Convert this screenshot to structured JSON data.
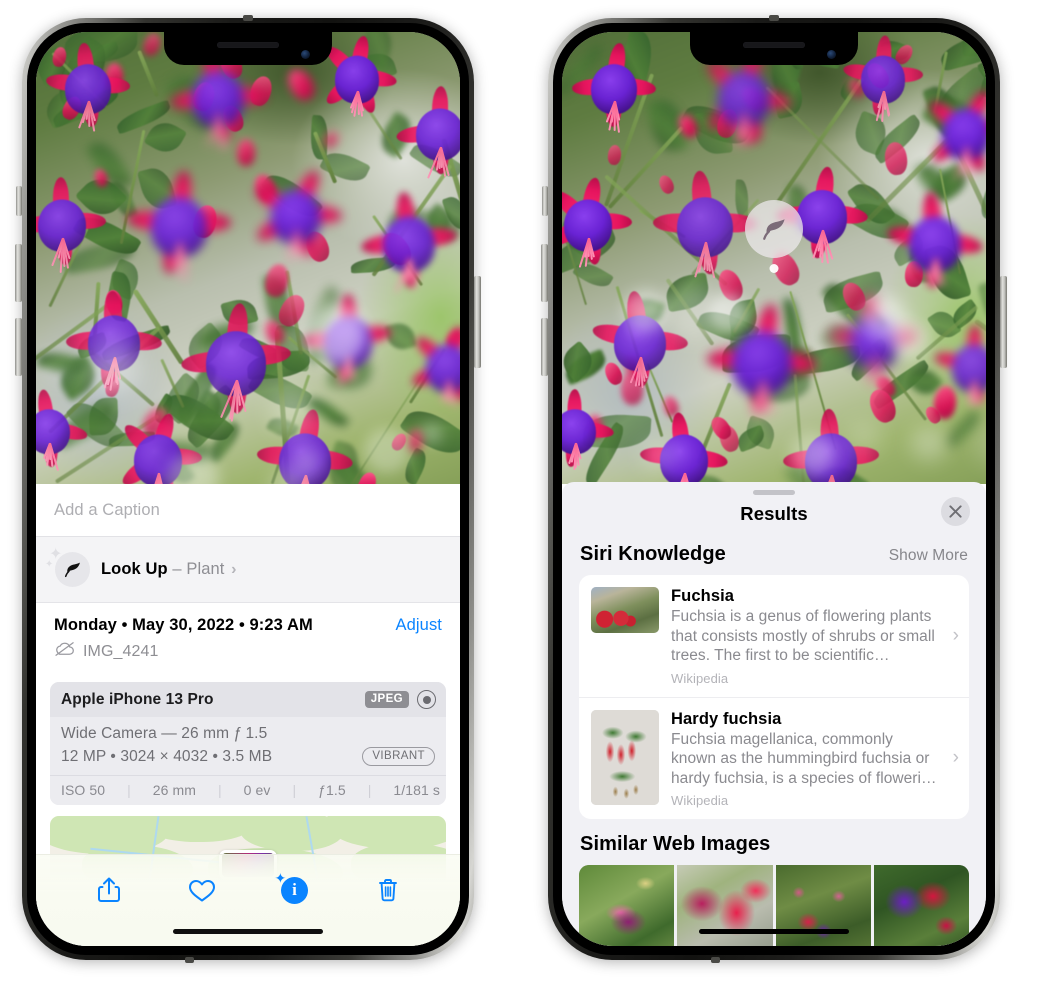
{
  "meta": {
    "accent_blue": "#0a84ff",
    "sheet_bg": "#f1f1f5",
    "card_bg": "#ffffff"
  },
  "left_phone": {
    "caption": {
      "placeholder": "Add a Caption",
      "value": ""
    },
    "lookup": {
      "icon": "leaf-icon",
      "label": "Look Up",
      "dash": "–",
      "category": "Plant",
      "chevron": "›"
    },
    "metadata": {
      "date_line": "Monday • May 30, 2022 • 9:23 AM",
      "adjust_label": "Adjust",
      "cloud_icon": "icloud-slash-icon",
      "filename": "IMG_4241"
    },
    "camera_card": {
      "model": "Apple iPhone 13 Pro",
      "format_badge": "JPEG",
      "raw_icon": "aperture-icon",
      "lens_line": "Wide Camera — 26 mm ƒ 1.5",
      "specs_line": "12 MP • 3024 × 4032 • 3.5 MB",
      "style_badge": "VIBRANT",
      "exif": [
        "ISO 50",
        "26 mm",
        "0 ev",
        "ƒ1.5",
        "1/181 s"
      ]
    },
    "toolbar": [
      {
        "name": "share-button",
        "icon": "share-icon"
      },
      {
        "name": "favorite-button",
        "icon": "heart-icon"
      },
      {
        "name": "info-button",
        "icon": "info-sparkle-icon",
        "glyph": "i"
      },
      {
        "name": "delete-button",
        "icon": "trash-icon"
      }
    ]
  },
  "right_phone": {
    "visual_lookup_badge": {
      "icon": "leaf-icon"
    },
    "sheet": {
      "title": "Results",
      "close_icon": "close-icon"
    },
    "siri_knowledge": {
      "title": "Siri Knowledge",
      "show_more": "Show More",
      "cards": [
        {
          "title": "Fuchsia",
          "description": "Fuchsia is a genus of flowering plants that consists mostly of shrubs or small trees. The first to be scientific…",
          "source": "Wikipedia",
          "thumb": "fuchsia-red-flowers-thumbnail",
          "chevron": "›"
        },
        {
          "title": "Hardy fuchsia",
          "description": "Fuchsia magellanica, commonly known as the hummingbird fuchsia or hardy fuchsia, is a species of floweri…",
          "source": "Wikipedia",
          "thumb": "hardy-fuchsia-specimen-thumbnail",
          "chevron": "›"
        }
      ]
    },
    "similar_web_images": {
      "title": "Similar Web Images",
      "images": [
        {
          "name": "web-image-1",
          "alt": "pink and magenta fuchsia with green leaves"
        },
        {
          "name": "web-image-2",
          "alt": "red and magenta fuchsia close up"
        },
        {
          "name": "web-image-3",
          "alt": "fuchsia bush with buds"
        },
        {
          "name": "web-image-4",
          "alt": "purple and red fuchsia blooms"
        }
      ]
    }
  }
}
